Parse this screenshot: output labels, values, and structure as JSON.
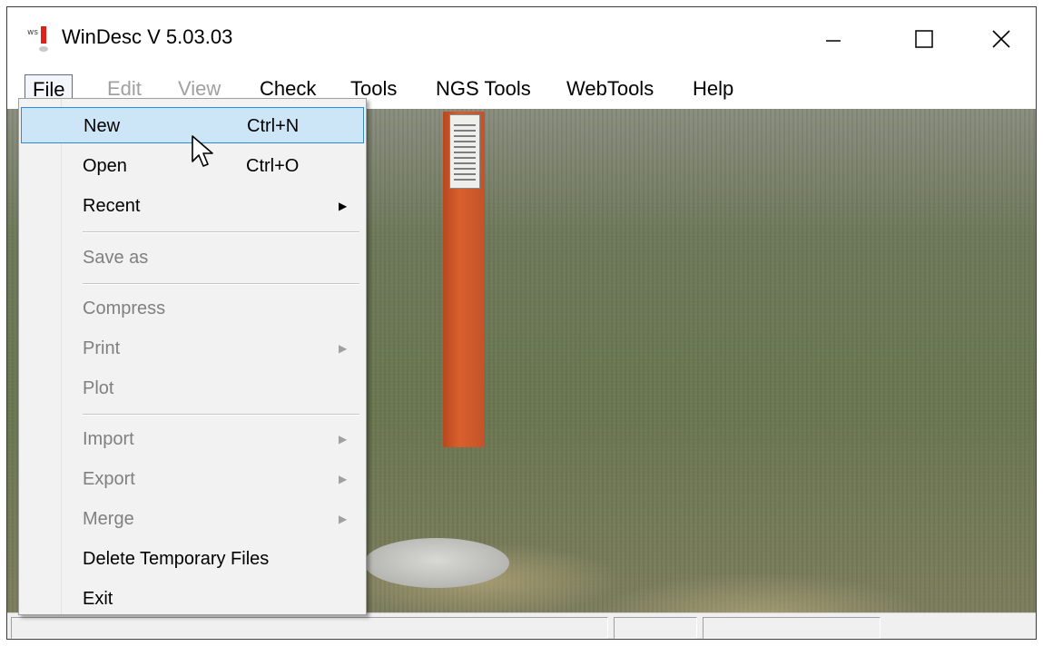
{
  "window": {
    "title": "WinDesc V 5.03.03",
    "icon": "app-exclamation-icon",
    "caption_buttons": {
      "minimize": "minimize-icon",
      "maximize": "maximize-icon",
      "close": "close-icon"
    }
  },
  "menubar": {
    "items": [
      {
        "label": "File",
        "enabled": true,
        "active": true
      },
      {
        "label": "Edit",
        "enabled": false
      },
      {
        "label": "View",
        "enabled": false
      },
      {
        "label": "Check",
        "enabled": true
      },
      {
        "label": "Tools",
        "enabled": true
      },
      {
        "label": "NGS Tools",
        "enabled": true
      },
      {
        "label": "WebTools",
        "enabled": true
      },
      {
        "label": "Help",
        "enabled": true
      }
    ]
  },
  "file_menu": {
    "items": [
      {
        "label": "New",
        "shortcut": "Ctrl+N",
        "enabled": true,
        "highlighted": true
      },
      {
        "label": "Open",
        "shortcut": "Ctrl+O",
        "enabled": true
      },
      {
        "label": "Recent",
        "submenu": true,
        "enabled": true
      },
      {
        "label": "Save as",
        "enabled": false
      },
      {
        "label": "Compress",
        "enabled": false
      },
      {
        "label": "Print",
        "submenu": true,
        "enabled": false
      },
      {
        "label": "Plot",
        "enabled": false
      },
      {
        "label": "Import",
        "submenu": true,
        "enabled": false
      },
      {
        "label": "Export",
        "submenu": true,
        "enabled": false
      },
      {
        "label": "Merge",
        "submenu": true,
        "enabled": false
      },
      {
        "label": "Delete Temporary Files",
        "enabled": true
      },
      {
        "label": "Exit",
        "enabled": true
      }
    ]
  },
  "colors": {
    "highlight_bg": "#cde6f7",
    "highlight_border": "#2e8ad6",
    "disabled_text": "#808080",
    "menu_bg": "#f2f2f2",
    "post": "#d9602d"
  }
}
